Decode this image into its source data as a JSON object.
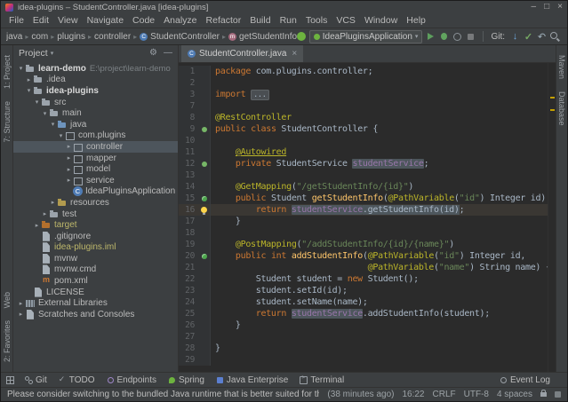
{
  "window": {
    "title": "idea-plugins – StudentController.java [idea-plugins]",
    "controls": [
      "–",
      "□",
      "×"
    ]
  },
  "menu": {
    "items": [
      "File",
      "Edit",
      "View",
      "Navigate",
      "Code",
      "Analyze",
      "Refactor",
      "Build",
      "Run",
      "Tools",
      "VCS",
      "Window",
      "Help"
    ]
  },
  "navbar": {
    "breadcrumb": [
      {
        "label": "java",
        "icon": "none"
      },
      {
        "label": "com",
        "icon": "none"
      },
      {
        "label": "plugins",
        "icon": "none"
      },
      {
        "label": "controller",
        "icon": "none"
      },
      {
        "label": "StudentController",
        "icon": "class"
      },
      {
        "label": "getStudentInfo",
        "icon": "method"
      }
    ],
    "run_config": "IdeaPluginsApplication",
    "run_actions": [
      {
        "name": "run-icon",
        "cls": "run"
      },
      {
        "name": "debug-icon",
        "cls": "bug"
      },
      {
        "name": "profiler-icon",
        "cls": "prof"
      },
      {
        "name": "stop-icon",
        "cls": "stop"
      }
    ],
    "git_label": "Git:",
    "git_actions": [
      {
        "name": "update-project-icon",
        "cls": "update"
      },
      {
        "name": "commit-icon",
        "cls": "commit"
      },
      {
        "name": "revert-icon",
        "cls": "revert"
      },
      {
        "name": "search-icon",
        "cls": "search"
      }
    ]
  },
  "left_strip": {
    "top": [
      "1: Project",
      "7: Structure"
    ],
    "bottom": [
      "Web",
      "2: Favorites"
    ]
  },
  "right_strip": {
    "top": [
      "Maven",
      "Database"
    ]
  },
  "project": {
    "header": "Project",
    "tree": [
      {
        "label": "learn-demo",
        "hint": "E:\\project\\learn-demo",
        "indent": 0,
        "arrow": "open",
        "icon": "folder",
        "bold": true
      },
      {
        "label": ".idea",
        "indent": 1,
        "arrow": "closed",
        "icon": "folder"
      },
      {
        "label": "idea-plugins",
        "indent": 1,
        "arrow": "open",
        "icon": "folder",
        "bold": true
      },
      {
        "label": "src",
        "indent": 2,
        "arrow": "open",
        "icon": "folder"
      },
      {
        "label": "main",
        "indent": 3,
        "arrow": "open",
        "icon": "folder"
      },
      {
        "label": "java",
        "indent": 4,
        "arrow": "open",
        "icon": "src"
      },
      {
        "label": "com.plugins",
        "indent": 5,
        "arrow": "open",
        "icon": "package"
      },
      {
        "label": "controller",
        "indent": 6,
        "arrow": "closed",
        "icon": "package",
        "selected": true
      },
      {
        "label": "mapper",
        "indent": 6,
        "arrow": "closed",
        "icon": "package"
      },
      {
        "label": "model",
        "indent": 6,
        "arrow": "closed",
        "icon": "package"
      },
      {
        "label": "service",
        "indent": 6,
        "arrow": "closed",
        "icon": "package"
      },
      {
        "label": "IdeaPluginsApplication",
        "indent": 6,
        "icon": "class"
      },
      {
        "label": "resources",
        "indent": 4,
        "arrow": "closed",
        "icon": "res"
      },
      {
        "label": "test",
        "indent": 3,
        "arrow": "closed",
        "icon": "folder"
      },
      {
        "label": "target",
        "indent": 2,
        "arrow": "closed",
        "icon": "excluded",
        "ignored": true
      },
      {
        "label": ".gitignore",
        "indent": 2,
        "icon": "file"
      },
      {
        "label": "idea-plugins.iml",
        "indent": 2,
        "icon": "file",
        "ignored": true
      },
      {
        "label": "mvnw",
        "indent": 2,
        "icon": "file"
      },
      {
        "label": "mvnw.cmd",
        "indent": 2,
        "icon": "file"
      },
      {
        "label": "pom.xml",
        "indent": 2,
        "icon": "maven"
      },
      {
        "label": "LICENSE",
        "indent": 1,
        "icon": "file"
      },
      {
        "label": "External Libraries",
        "indent": 0,
        "arrow": "closed",
        "icon": "lib"
      },
      {
        "label": "Scratches and Consoles",
        "indent": 0,
        "arrow": "closed",
        "icon": "scratch"
      }
    ]
  },
  "editor": {
    "tab": "StudentController.java",
    "lines": [
      {
        "n": 1,
        "t": [
          [
            "kw",
            "package"
          ],
          [
            "d",
            " com.plugins.controller;"
          ]
        ]
      },
      {
        "n": 2,
        "t": []
      },
      {
        "n": 3,
        "t": [
          [
            "kw",
            "import"
          ],
          [
            "d",
            " "
          ],
          [
            "fold",
            "..."
          ]
        ]
      },
      {
        "n": 7,
        "t": []
      },
      {
        "n": 8,
        "t": [
          [
            "ann",
            "@RestController"
          ]
        ]
      },
      {
        "n": 9,
        "t": [
          [
            "kw",
            "public"
          ],
          [
            "d",
            " "
          ],
          [
            "kw",
            "class"
          ],
          [
            "d",
            " StudentController {"
          ]
        ],
        "g": "bean"
      },
      {
        "n": 10,
        "t": []
      },
      {
        "n": 11,
        "t": [
          [
            "d",
            "    "
          ],
          [
            "annu",
            "@Autowired"
          ]
        ]
      },
      {
        "n": 12,
        "t": [
          [
            "d",
            "    "
          ],
          [
            "kw",
            "private"
          ],
          [
            "d",
            " StudentService "
          ],
          [
            "fldhl",
            "studentService"
          ],
          [
            "d",
            ";"
          ]
        ],
        "g": "bean"
      },
      {
        "n": 13,
        "t": []
      },
      {
        "n": 14,
        "t": [
          [
            "d",
            "    "
          ],
          [
            "ann",
            "@GetMapping"
          ],
          [
            "d",
            "("
          ],
          [
            "str",
            "\"/getStudentInfo/{id}\""
          ],
          [
            "d",
            ")"
          ]
        ]
      },
      {
        "n": 15,
        "t": [
          [
            "d",
            "    "
          ],
          [
            "kw",
            "public"
          ],
          [
            "d",
            " Student "
          ],
          [
            "mth",
            "getStudentInfo"
          ],
          [
            "d",
            "("
          ],
          [
            "ann",
            "@PathVariable"
          ],
          [
            "d",
            "("
          ],
          [
            "str",
            "\"id\""
          ],
          [
            "d",
            ") Integer id) {"
          ]
        ],
        "g": "mapping"
      },
      {
        "n": 16,
        "t": [
          [
            "d",
            "        "
          ],
          [
            "kw",
            "return"
          ],
          [
            "d",
            " "
          ],
          [
            "fldhl",
            "studentService"
          ],
          [
            "dhl",
            ".getStudentInfo(id)"
          ],
          [
            "d",
            ";"
          ]
        ],
        "g": "bulb",
        "cur": true
      },
      {
        "n": 17,
        "t": [
          [
            "d",
            "    }"
          ]
        ]
      },
      {
        "n": 18,
        "t": []
      },
      {
        "n": 19,
        "t": [
          [
            "d",
            "    "
          ],
          [
            "ann",
            "@PostMapping"
          ],
          [
            "d",
            "("
          ],
          [
            "str",
            "\"/addStudentInfo/{id}/{name}\""
          ],
          [
            "d",
            ")"
          ]
        ]
      },
      {
        "n": 20,
        "t": [
          [
            "d",
            "    "
          ],
          [
            "kw",
            "public"
          ],
          [
            "d",
            " "
          ],
          [
            "kw",
            "int"
          ],
          [
            "d",
            " "
          ],
          [
            "mth",
            "addStudentInfo"
          ],
          [
            "d",
            "("
          ],
          [
            "ann",
            "@PathVariable"
          ],
          [
            "d",
            "("
          ],
          [
            "str",
            "\"id\""
          ],
          [
            "d",
            ") Integer id,"
          ]
        ],
        "g": "mapping"
      },
      {
        "n": 21,
        "t": [
          [
            "d",
            "                              "
          ],
          [
            "ann",
            "@PathVariable"
          ],
          [
            "d",
            "("
          ],
          [
            "str",
            "\"name\""
          ],
          [
            "d",
            ") String name) {"
          ]
        ]
      },
      {
        "n": 22,
        "t": [
          [
            "d",
            "        Student student = "
          ],
          [
            "kw",
            "new"
          ],
          [
            "d",
            " Student();"
          ]
        ]
      },
      {
        "n": 23,
        "t": [
          [
            "d",
            "        student.setId(id);"
          ]
        ]
      },
      {
        "n": 24,
        "t": [
          [
            "d",
            "        student.setName(name);"
          ]
        ]
      },
      {
        "n": 25,
        "t": [
          [
            "d",
            "        "
          ],
          [
            "kw",
            "return"
          ],
          [
            "d",
            " "
          ],
          [
            "fldhl",
            "studentService"
          ],
          [
            "d",
            ".addStudentInfo(student);"
          ]
        ]
      },
      {
        "n": 26,
        "t": [
          [
            "d",
            "    }"
          ]
        ]
      },
      {
        "n": 27,
        "t": []
      },
      {
        "n": 28,
        "t": [
          [
            "d",
            "}"
          ]
        ]
      },
      {
        "n": 29,
        "t": []
      }
    ]
  },
  "bottom_bar": {
    "left": [
      {
        "label": "Git",
        "icon": "git"
      },
      {
        "label": "TODO",
        "icon": "todo"
      },
      {
        "label": "Endpoints",
        "icon": "endpoints"
      },
      {
        "label": "Spring",
        "icon": "spring"
      },
      {
        "label": "Java Enterprise",
        "icon": "javaee"
      },
      {
        "label": "Terminal",
        "icon": "terminal"
      }
    ],
    "right": [
      {
        "label": "Event Log",
        "icon": "event"
      }
    ]
  },
  "status_bar": {
    "message": "Please consider switching to the bundled Java runtime that is better suited for the IDE (your current Java run...",
    "items": [
      "(38 minutes ago)",
      "16:22",
      "CRLF",
      "UTF-8",
      "4 spaces"
    ]
  }
}
